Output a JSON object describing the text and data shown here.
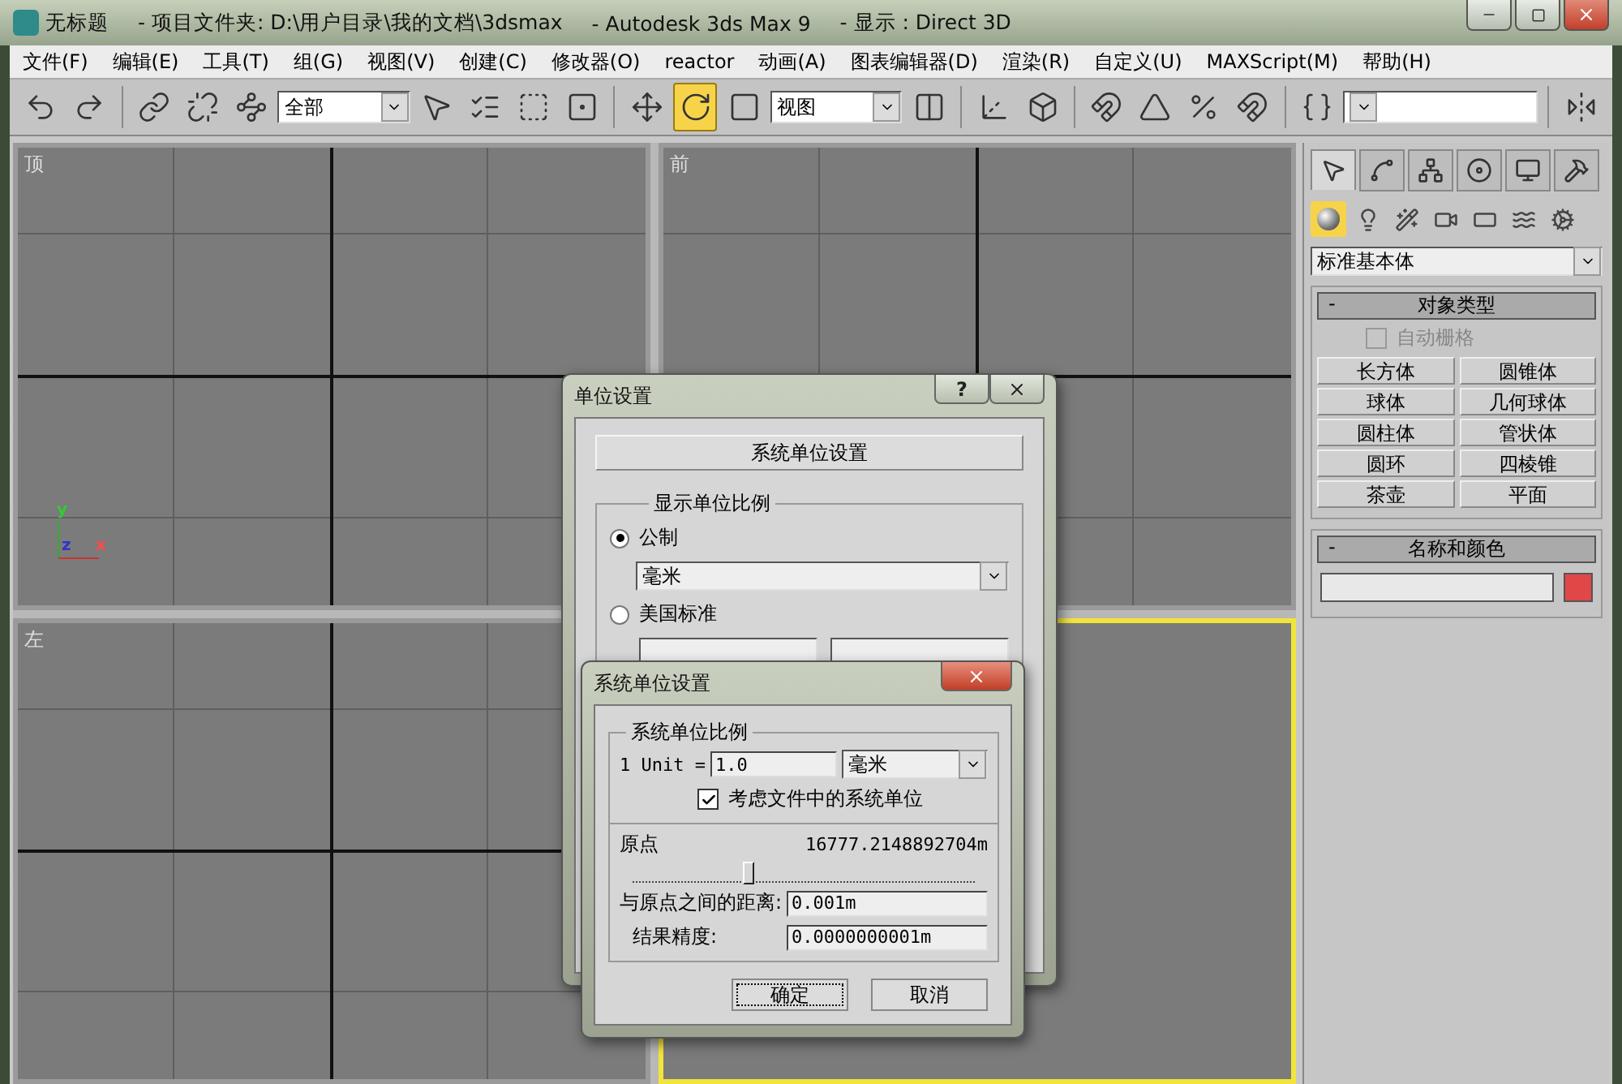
{
  "window": {
    "title": "无标题",
    "project": "- 项目文件夹: D:\\用户目录\\我的文档\\3dsmax",
    "app": "- Autodesk 3ds Max 9",
    "display": "- 显示 : Direct 3D"
  },
  "menu": [
    "文件(F)",
    "编辑(E)",
    "工具(T)",
    "组(G)",
    "视图(V)",
    "创建(C)",
    "修改器(O)",
    "reactor",
    "动画(A)",
    "图表编辑器(D)",
    "渲染(R)",
    "自定义(U)",
    "MAXScript(M)",
    "帮助(H)"
  ],
  "toolbar": [
    {
      "kind": "icon",
      "selected": false
    },
    {
      "kind": "icon",
      "selected": false
    },
    {
      "kind": "separator"
    },
    {
      "kind": "icon",
      "selected": false
    },
    {
      "kind": "icon",
      "selected": false
    },
    {
      "kind": "icon",
      "selected": false
    },
    {
      "kind": "dropdown",
      "value": "全部"
    },
    {
      "kind": "icon",
      "selected": false
    },
    {
      "kind": "icon",
      "selected": false
    },
    {
      "kind": "icon",
      "selected": false
    },
    {
      "kind": "icon",
      "selected": false
    },
    {
      "kind": "separator"
    },
    {
      "kind": "icon",
      "selected": false
    },
    {
      "kind": "icon",
      "selected": true
    },
    {
      "kind": "icon",
      "selected": false
    },
    {
      "kind": "dropdown",
      "value": "视图"
    },
    {
      "kind": "icon",
      "selected": false
    },
    {
      "kind": "separator"
    },
    {
      "kind": "icon",
      "selected": false
    },
    {
      "kind": "icon",
      "selected": false
    },
    {
      "kind": "separator"
    },
    {
      "kind": "icon",
      "selected": false
    },
    {
      "kind": "icon",
      "selected": false
    },
    {
      "kind": "icon",
      "selected": false
    },
    {
      "kind": "icon",
      "selected": false
    },
    {
      "kind": "separator"
    },
    {
      "kind": "icon",
      "selected": false
    },
    {
      "kind": "dropdown"
    },
    {
      "kind": "separator"
    },
    {
      "kind": "icon",
      "selected": false
    }
  ],
  "viewports": [
    {
      "kind": "ortho",
      "label": "顶",
      "active": false,
      "axes": {
        "y": "y",
        "z": "z",
        "x": "x"
      }
    },
    {
      "kind": "ortho",
      "label": "前",
      "active": false
    },
    {
      "kind": "ortho",
      "label": "左",
      "active": false
    },
    {
      "kind": "perspective",
      "active": true
    }
  ],
  "command_panel": {
    "tabs": [
      {
        "selected": true
      },
      {
        "selected": false
      },
      {
        "selected": false
      },
      {
        "selected": false
      },
      {
        "selected": false
      },
      {
        "selected": false
      }
    ],
    "categories": [
      {
        "selected": true
      },
      {
        "selected": false
      },
      {
        "selected": false
      },
      {
        "selected": false
      },
      {
        "selected": false
      },
      {
        "selected": false
      },
      {
        "selected": false
      }
    ],
    "type_dropdown": "标准基本体",
    "object_type": {
      "toggle": "-",
      "title": "对象类型",
      "autogrid": {
        "label": "自动栅格",
        "checked": false,
        "disabled": true
      },
      "buttons": [
        "长方体",
        "圆锥体",
        "球体",
        "几何球体",
        "圆柱体",
        "管状体",
        "圆环",
        "四棱锥",
        "茶壶",
        "平面"
      ]
    },
    "name_color": {
      "toggle": "-",
      "title": "名称和颜色",
      "color": "#e04848"
    }
  },
  "units_dialog": {
    "title": "单位设置",
    "help": "?",
    "system_button": "系统单位设置",
    "group": "显示单位比例",
    "options": [
      {
        "label": "公制",
        "selected": true
      },
      {
        "label": "美国标准",
        "selected": false
      }
    ],
    "metric_unit": "毫米"
  },
  "system_dialog": {
    "title": "系统单位设置",
    "group": "系统单位比例",
    "unit_label": "1 Unit =",
    "unit_value": "1.0",
    "unit": "毫米",
    "consider": {
      "label": "考虑文件中的系统单位",
      "checked": true
    },
    "origin_label": "原点",
    "origin_value": "16777.2148892704m",
    "slider": {
      "level": 0.32
    },
    "distance_label": "与原点之间的距离:",
    "distance_value": "0.001m",
    "precision_label": "结果精度:",
    "precision_value": "0.0000000001m",
    "buttons": [
      {
        "label": "确定",
        "focused": true
      },
      {
        "label": "取消",
        "focused": false
      }
    ]
  }
}
